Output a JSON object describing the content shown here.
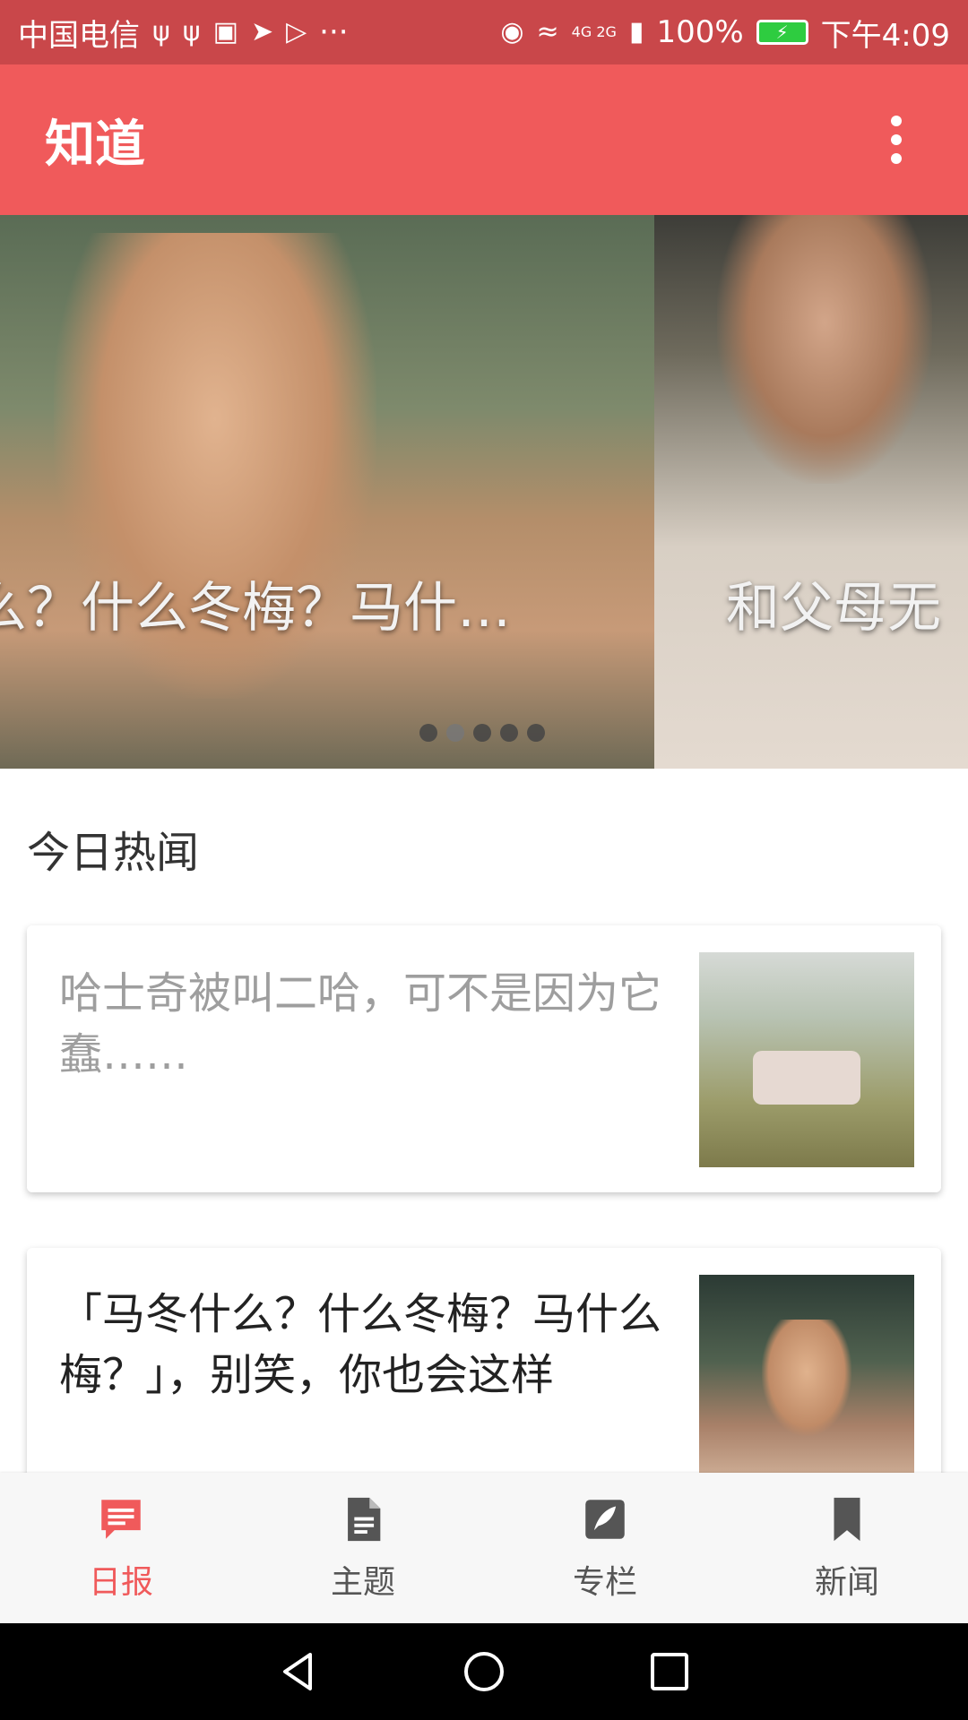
{
  "status_bar": {
    "carrier": "中国电信",
    "more": "···",
    "network": "4G 2G",
    "battery_percent": "100%",
    "time": "下午4:09"
  },
  "app_bar": {
    "title": "知道"
  },
  "banner": {
    "slides": [
      {
        "title": "么？什么冬梅？马什…"
      },
      {
        "title": "和父母无"
      }
    ],
    "dot_count": 5,
    "active_dot": 1
  },
  "section": {
    "title": "今日热闻"
  },
  "stories": [
    {
      "title": "哈士奇被叫二哈，可不是因为它蠢……",
      "read": true
    },
    {
      "title": "「马冬什么？什么冬梅？马什么梅？」，别笑，你也会这样",
      "read": false
    }
  ],
  "bottom_nav": {
    "items": [
      {
        "label": "日报",
        "icon": "daily-icon"
      },
      {
        "label": "主题",
        "icon": "document-icon"
      },
      {
        "label": "专栏",
        "icon": "feather-icon"
      },
      {
        "label": "新闻",
        "icon": "bookmark-icon"
      }
    ],
    "active_index": 0
  },
  "colors": {
    "status_bar": "#c9474a",
    "app_bar": "#f05a5b",
    "accent": "#f05a5b"
  }
}
